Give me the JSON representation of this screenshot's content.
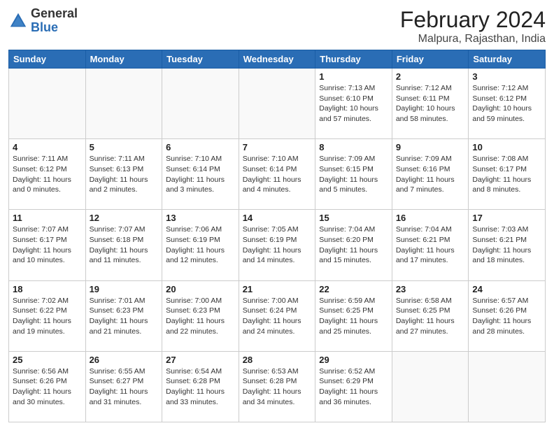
{
  "header": {
    "logo_general": "General",
    "logo_blue": "Blue",
    "month_year": "February 2024",
    "location": "Malpura, Rajasthan, India"
  },
  "days_of_week": [
    "Sunday",
    "Monday",
    "Tuesday",
    "Wednesday",
    "Thursday",
    "Friday",
    "Saturday"
  ],
  "weeks": [
    [
      {
        "day": "",
        "info": ""
      },
      {
        "day": "",
        "info": ""
      },
      {
        "day": "",
        "info": ""
      },
      {
        "day": "",
        "info": ""
      },
      {
        "day": "1",
        "info": "Sunrise: 7:13 AM\nSunset: 6:10 PM\nDaylight: 10 hours\nand 57 minutes."
      },
      {
        "day": "2",
        "info": "Sunrise: 7:12 AM\nSunset: 6:11 PM\nDaylight: 10 hours\nand 58 minutes."
      },
      {
        "day": "3",
        "info": "Sunrise: 7:12 AM\nSunset: 6:12 PM\nDaylight: 10 hours\nand 59 minutes."
      }
    ],
    [
      {
        "day": "4",
        "info": "Sunrise: 7:11 AM\nSunset: 6:12 PM\nDaylight: 11 hours\nand 0 minutes."
      },
      {
        "day": "5",
        "info": "Sunrise: 7:11 AM\nSunset: 6:13 PM\nDaylight: 11 hours\nand 2 minutes."
      },
      {
        "day": "6",
        "info": "Sunrise: 7:10 AM\nSunset: 6:14 PM\nDaylight: 11 hours\nand 3 minutes."
      },
      {
        "day": "7",
        "info": "Sunrise: 7:10 AM\nSunset: 6:14 PM\nDaylight: 11 hours\nand 4 minutes."
      },
      {
        "day": "8",
        "info": "Sunrise: 7:09 AM\nSunset: 6:15 PM\nDaylight: 11 hours\nand 5 minutes."
      },
      {
        "day": "9",
        "info": "Sunrise: 7:09 AM\nSunset: 6:16 PM\nDaylight: 11 hours\nand 7 minutes."
      },
      {
        "day": "10",
        "info": "Sunrise: 7:08 AM\nSunset: 6:17 PM\nDaylight: 11 hours\nand 8 minutes."
      }
    ],
    [
      {
        "day": "11",
        "info": "Sunrise: 7:07 AM\nSunset: 6:17 PM\nDaylight: 11 hours\nand 10 minutes."
      },
      {
        "day": "12",
        "info": "Sunrise: 7:07 AM\nSunset: 6:18 PM\nDaylight: 11 hours\nand 11 minutes."
      },
      {
        "day": "13",
        "info": "Sunrise: 7:06 AM\nSunset: 6:19 PM\nDaylight: 11 hours\nand 12 minutes."
      },
      {
        "day": "14",
        "info": "Sunrise: 7:05 AM\nSunset: 6:19 PM\nDaylight: 11 hours\nand 14 minutes."
      },
      {
        "day": "15",
        "info": "Sunrise: 7:04 AM\nSunset: 6:20 PM\nDaylight: 11 hours\nand 15 minutes."
      },
      {
        "day": "16",
        "info": "Sunrise: 7:04 AM\nSunset: 6:21 PM\nDaylight: 11 hours\nand 17 minutes."
      },
      {
        "day": "17",
        "info": "Sunrise: 7:03 AM\nSunset: 6:21 PM\nDaylight: 11 hours\nand 18 minutes."
      }
    ],
    [
      {
        "day": "18",
        "info": "Sunrise: 7:02 AM\nSunset: 6:22 PM\nDaylight: 11 hours\nand 19 minutes."
      },
      {
        "day": "19",
        "info": "Sunrise: 7:01 AM\nSunset: 6:23 PM\nDaylight: 11 hours\nand 21 minutes."
      },
      {
        "day": "20",
        "info": "Sunrise: 7:00 AM\nSunset: 6:23 PM\nDaylight: 11 hours\nand 22 minutes."
      },
      {
        "day": "21",
        "info": "Sunrise: 7:00 AM\nSunset: 6:24 PM\nDaylight: 11 hours\nand 24 minutes."
      },
      {
        "day": "22",
        "info": "Sunrise: 6:59 AM\nSunset: 6:25 PM\nDaylight: 11 hours\nand 25 minutes."
      },
      {
        "day": "23",
        "info": "Sunrise: 6:58 AM\nSunset: 6:25 PM\nDaylight: 11 hours\nand 27 minutes."
      },
      {
        "day": "24",
        "info": "Sunrise: 6:57 AM\nSunset: 6:26 PM\nDaylight: 11 hours\nand 28 minutes."
      }
    ],
    [
      {
        "day": "25",
        "info": "Sunrise: 6:56 AM\nSunset: 6:26 PM\nDaylight: 11 hours\nand 30 minutes."
      },
      {
        "day": "26",
        "info": "Sunrise: 6:55 AM\nSunset: 6:27 PM\nDaylight: 11 hours\nand 31 minutes."
      },
      {
        "day": "27",
        "info": "Sunrise: 6:54 AM\nSunset: 6:28 PM\nDaylight: 11 hours\nand 33 minutes."
      },
      {
        "day": "28",
        "info": "Sunrise: 6:53 AM\nSunset: 6:28 PM\nDaylight: 11 hours\nand 34 minutes."
      },
      {
        "day": "29",
        "info": "Sunrise: 6:52 AM\nSunset: 6:29 PM\nDaylight: 11 hours\nand 36 minutes."
      },
      {
        "day": "",
        "info": ""
      },
      {
        "day": "",
        "info": ""
      }
    ]
  ]
}
